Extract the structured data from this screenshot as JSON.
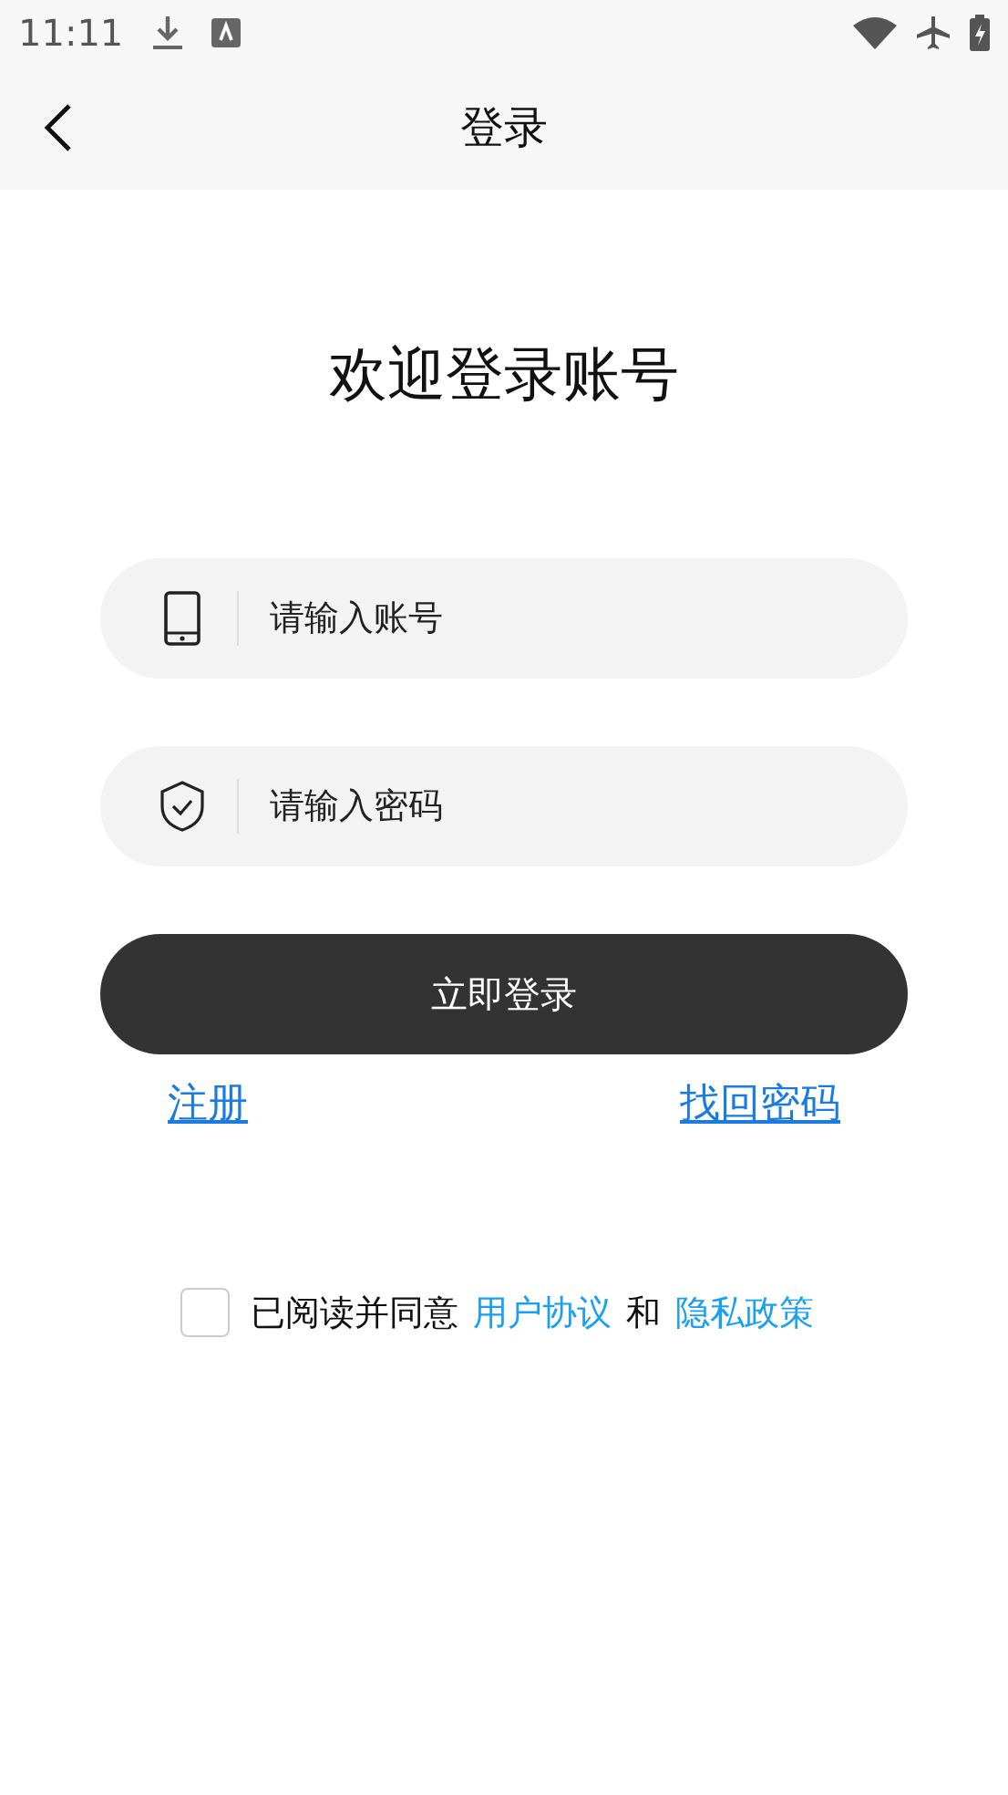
{
  "status_bar": {
    "time": "11:11"
  },
  "header": {
    "title": "登录"
  },
  "heading": "欢迎登录账号",
  "fields": [
    {
      "kind": "phone",
      "placeholder": "请输入账号"
    },
    {
      "kind": "shield",
      "placeholder": "请输入密码"
    }
  ],
  "login_button": "立即登录",
  "links": [
    {
      "label": "注册"
    },
    {
      "label": "找回密码"
    }
  ],
  "agreement": {
    "checked": false,
    "text": "已阅读并同意",
    "terms": "用户协议",
    "conjunction": "和",
    "privacy": "隐私政策"
  }
}
